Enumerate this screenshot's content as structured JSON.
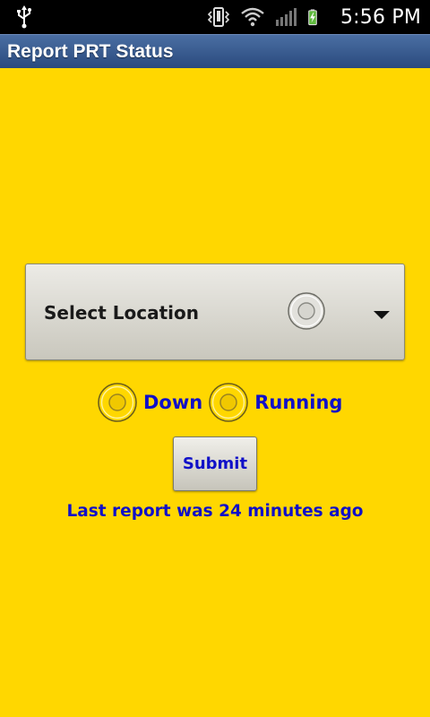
{
  "status_bar": {
    "time": "5:56 PM",
    "icons": [
      "usb-icon",
      "vibrate-icon",
      "wifi-icon",
      "signal-icon",
      "battery-charging-icon"
    ]
  },
  "header": {
    "title": "Report PRT Status"
  },
  "location_select": {
    "placeholder": "Select Location"
  },
  "status_options": [
    {
      "label": "Down",
      "checked": false
    },
    {
      "label": "Running",
      "checked": false
    }
  ],
  "submit_label": "Submit",
  "last_report": "Last report was 24 minutes ago",
  "colors": {
    "background": "#ffd700",
    "title_bar": "#3a5c91",
    "accent_text": "#1010c8"
  }
}
